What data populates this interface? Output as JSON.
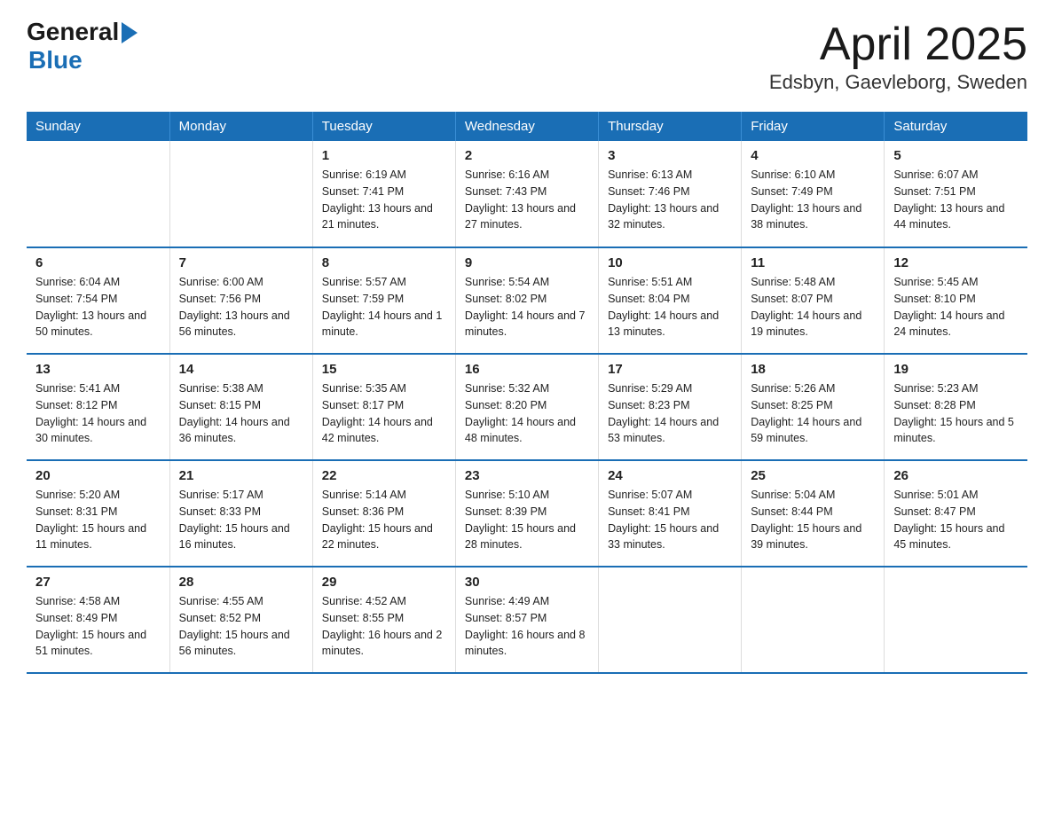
{
  "logo": {
    "general": "General",
    "blue": "Blue"
  },
  "title": "April 2025",
  "subtitle": "Edsbyn, Gaevleborg, Sweden",
  "headers": [
    "Sunday",
    "Monday",
    "Tuesday",
    "Wednesday",
    "Thursday",
    "Friday",
    "Saturday"
  ],
  "weeks": [
    [
      {
        "day": "",
        "info": ""
      },
      {
        "day": "",
        "info": ""
      },
      {
        "day": "1",
        "info": "Sunrise: 6:19 AM\nSunset: 7:41 PM\nDaylight: 13 hours\nand 21 minutes."
      },
      {
        "day": "2",
        "info": "Sunrise: 6:16 AM\nSunset: 7:43 PM\nDaylight: 13 hours\nand 27 minutes."
      },
      {
        "day": "3",
        "info": "Sunrise: 6:13 AM\nSunset: 7:46 PM\nDaylight: 13 hours\nand 32 minutes."
      },
      {
        "day": "4",
        "info": "Sunrise: 6:10 AM\nSunset: 7:49 PM\nDaylight: 13 hours\nand 38 minutes."
      },
      {
        "day": "5",
        "info": "Sunrise: 6:07 AM\nSunset: 7:51 PM\nDaylight: 13 hours\nand 44 minutes."
      }
    ],
    [
      {
        "day": "6",
        "info": "Sunrise: 6:04 AM\nSunset: 7:54 PM\nDaylight: 13 hours\nand 50 minutes."
      },
      {
        "day": "7",
        "info": "Sunrise: 6:00 AM\nSunset: 7:56 PM\nDaylight: 13 hours\nand 56 minutes."
      },
      {
        "day": "8",
        "info": "Sunrise: 5:57 AM\nSunset: 7:59 PM\nDaylight: 14 hours\nand 1 minute."
      },
      {
        "day": "9",
        "info": "Sunrise: 5:54 AM\nSunset: 8:02 PM\nDaylight: 14 hours\nand 7 minutes."
      },
      {
        "day": "10",
        "info": "Sunrise: 5:51 AM\nSunset: 8:04 PM\nDaylight: 14 hours\nand 13 minutes."
      },
      {
        "day": "11",
        "info": "Sunrise: 5:48 AM\nSunset: 8:07 PM\nDaylight: 14 hours\nand 19 minutes."
      },
      {
        "day": "12",
        "info": "Sunrise: 5:45 AM\nSunset: 8:10 PM\nDaylight: 14 hours\nand 24 minutes."
      }
    ],
    [
      {
        "day": "13",
        "info": "Sunrise: 5:41 AM\nSunset: 8:12 PM\nDaylight: 14 hours\nand 30 minutes."
      },
      {
        "day": "14",
        "info": "Sunrise: 5:38 AM\nSunset: 8:15 PM\nDaylight: 14 hours\nand 36 minutes."
      },
      {
        "day": "15",
        "info": "Sunrise: 5:35 AM\nSunset: 8:17 PM\nDaylight: 14 hours\nand 42 minutes."
      },
      {
        "day": "16",
        "info": "Sunrise: 5:32 AM\nSunset: 8:20 PM\nDaylight: 14 hours\nand 48 minutes."
      },
      {
        "day": "17",
        "info": "Sunrise: 5:29 AM\nSunset: 8:23 PM\nDaylight: 14 hours\nand 53 minutes."
      },
      {
        "day": "18",
        "info": "Sunrise: 5:26 AM\nSunset: 8:25 PM\nDaylight: 14 hours\nand 59 minutes."
      },
      {
        "day": "19",
        "info": "Sunrise: 5:23 AM\nSunset: 8:28 PM\nDaylight: 15 hours\nand 5 minutes."
      }
    ],
    [
      {
        "day": "20",
        "info": "Sunrise: 5:20 AM\nSunset: 8:31 PM\nDaylight: 15 hours\nand 11 minutes."
      },
      {
        "day": "21",
        "info": "Sunrise: 5:17 AM\nSunset: 8:33 PM\nDaylight: 15 hours\nand 16 minutes."
      },
      {
        "day": "22",
        "info": "Sunrise: 5:14 AM\nSunset: 8:36 PM\nDaylight: 15 hours\nand 22 minutes."
      },
      {
        "day": "23",
        "info": "Sunrise: 5:10 AM\nSunset: 8:39 PM\nDaylight: 15 hours\nand 28 minutes."
      },
      {
        "day": "24",
        "info": "Sunrise: 5:07 AM\nSunset: 8:41 PM\nDaylight: 15 hours\nand 33 minutes."
      },
      {
        "day": "25",
        "info": "Sunrise: 5:04 AM\nSunset: 8:44 PM\nDaylight: 15 hours\nand 39 minutes."
      },
      {
        "day": "26",
        "info": "Sunrise: 5:01 AM\nSunset: 8:47 PM\nDaylight: 15 hours\nand 45 minutes."
      }
    ],
    [
      {
        "day": "27",
        "info": "Sunrise: 4:58 AM\nSunset: 8:49 PM\nDaylight: 15 hours\nand 51 minutes."
      },
      {
        "day": "28",
        "info": "Sunrise: 4:55 AM\nSunset: 8:52 PM\nDaylight: 15 hours\nand 56 minutes."
      },
      {
        "day": "29",
        "info": "Sunrise: 4:52 AM\nSunset: 8:55 PM\nDaylight: 16 hours\nand 2 minutes."
      },
      {
        "day": "30",
        "info": "Sunrise: 4:49 AM\nSunset: 8:57 PM\nDaylight: 16 hours\nand 8 minutes."
      },
      {
        "day": "",
        "info": ""
      },
      {
        "day": "",
        "info": ""
      },
      {
        "day": "",
        "info": ""
      }
    ]
  ]
}
